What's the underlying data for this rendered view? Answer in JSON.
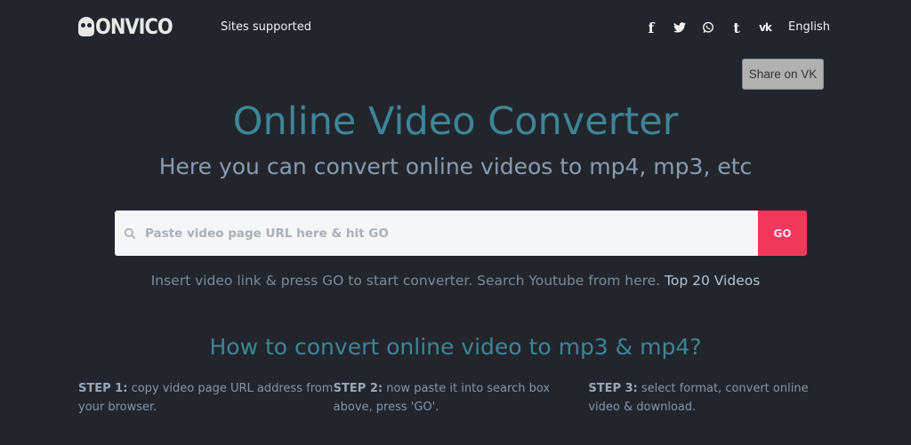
{
  "header": {
    "logo_text": "ONVICO",
    "nav_link": "Sites supported",
    "socials": [
      {
        "name": "facebook",
        "glyph": "f"
      },
      {
        "name": "twitter",
        "glyph": "🐦"
      },
      {
        "name": "whatsapp",
        "glyph": "✆"
      },
      {
        "name": "tumblr",
        "glyph": "t"
      },
      {
        "name": "vk",
        "glyph": "vk"
      }
    ],
    "language": "English"
  },
  "share_vk_label": "Share on VK",
  "hero": {
    "title": "Online Video Converter",
    "subtitle": "Here you can convert online videos to mp4, mp3, etc"
  },
  "search": {
    "placeholder": "Paste video page URL here & hit GO",
    "value": "",
    "go_label": "GO",
    "icon": "search-icon"
  },
  "hint": {
    "text": "Insert video link & press GO to start converter. Search Youtube from here.",
    "link": "Top 20 Videos"
  },
  "howto": {
    "title": "How to convert online video to mp3 & mp4?",
    "steps": [
      {
        "label": "STEP 1:",
        "text": "copy video page URL address from your browser."
      },
      {
        "label": "STEP 2:",
        "text": "now paste it into search box above, press 'GO'."
      },
      {
        "label": "STEP 3:",
        "text": "select format, convert online video & download."
      }
    ]
  },
  "colors": {
    "background": "#22252b",
    "accent_title": "#3f8497",
    "go_button": "#f2385a"
  }
}
